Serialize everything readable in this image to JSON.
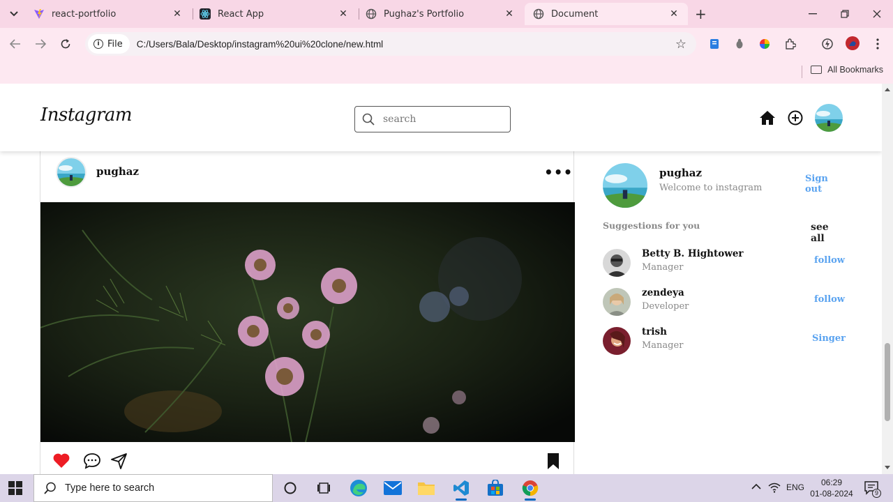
{
  "browser": {
    "tabs": [
      {
        "title": "react-portfolio",
        "favicon": "vite-icon",
        "active": false
      },
      {
        "title": "React App",
        "favicon": "react-icon",
        "active": false
      },
      {
        "title": "Pughaz's Portfolio",
        "favicon": "globe-icon",
        "active": false
      },
      {
        "title": "Document",
        "favicon": "globe-icon",
        "active": true
      }
    ],
    "file_chip": "File",
    "url": "C:/Users/Bala/Desktop/instagram%20ui%20clone/new.html",
    "all_bookmarks": "All Bookmarks"
  },
  "instagram": {
    "logo": "Instagram",
    "search_placeholder": "search",
    "post": {
      "username": "pughaz",
      "more": "•••"
    },
    "profile": {
      "username": "pughaz",
      "subtitle": "Welcome to instagram",
      "signout": "Sign out"
    },
    "suggestions_title": "Suggestions for you",
    "see_all": "see all",
    "suggestions": [
      {
        "name": "Betty B. Hightower",
        "role": "Manager",
        "action": "follow"
      },
      {
        "name": "zendeya",
        "role": "Developer",
        "action": "follow"
      },
      {
        "name": "trish",
        "role": "Manager",
        "action": "Singer"
      }
    ]
  },
  "taskbar": {
    "search_placeholder": "Type here to search",
    "language": "ENG",
    "time": "06:29",
    "date": "01-08-2024",
    "notifications": "9"
  },
  "colors": {
    "link": "#5aa3f0",
    "heart": "#ed1c24",
    "tabbar": "#f8d7e6",
    "toolbar": "#fde8f1"
  }
}
